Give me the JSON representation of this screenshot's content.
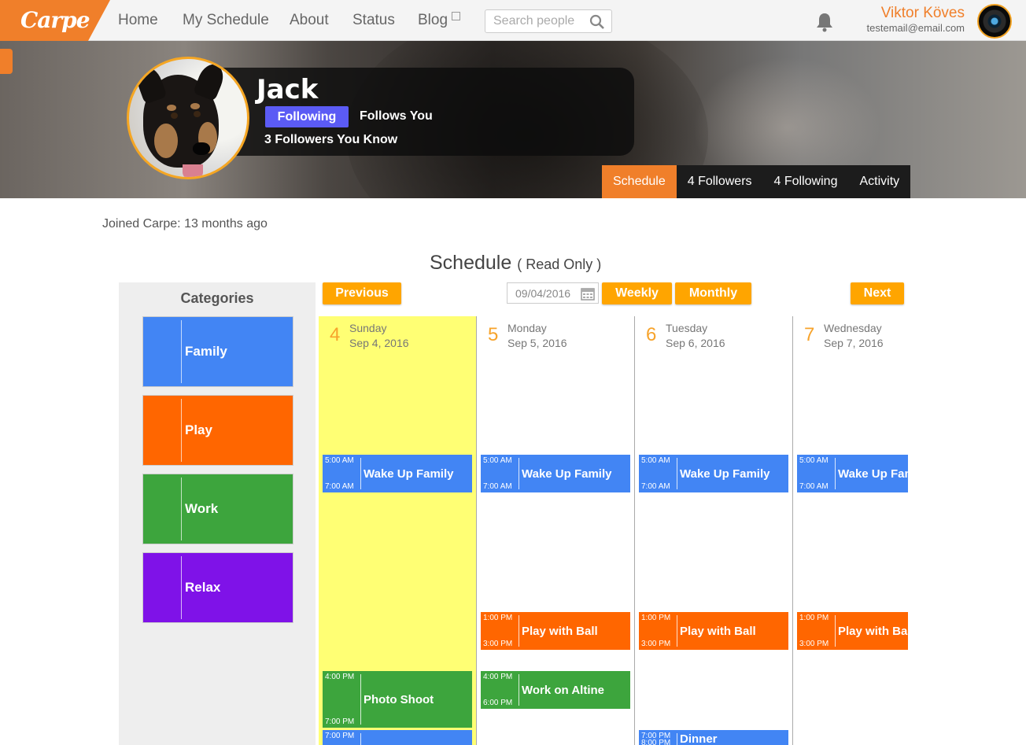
{
  "app": {
    "logo": "Carpe"
  },
  "nav": {
    "home": "Home",
    "my_schedule": "My Schedule",
    "about": "About",
    "status": "Status",
    "blog": "Blog"
  },
  "search": {
    "placeholder": "Search people"
  },
  "user": {
    "name": "Viktor Köves",
    "email": "testemail@email.com"
  },
  "profile": {
    "name": "Jack",
    "following_label": "Following",
    "follows_you": "Follows You",
    "followers_you_know": "3 Followers You Know",
    "tabs": [
      "Schedule",
      "4 Followers",
      "4 Following",
      "Activity"
    ],
    "joined": "Joined Carpe: 13 months ago"
  },
  "schedule": {
    "title": "Schedule",
    "subtitle": "( Read Only )",
    "previous": "Previous",
    "next": "Next",
    "weekly": "Weekly",
    "monthly": "Monthly",
    "date_value": "09/04/2016"
  },
  "categories": {
    "title": "Categories",
    "items": [
      {
        "label": "Family",
        "color": "#4285f4"
      },
      {
        "label": "Play",
        "color": "#ff6600"
      },
      {
        "label": "Work",
        "color": "#3da53d"
      },
      {
        "label": "Relax",
        "color": "#7f12e8"
      }
    ]
  },
  "days": [
    {
      "num": "4",
      "name": "Sunday",
      "date": "Sep 4, 2016",
      "today": true,
      "events": [
        {
          "title": "Wake Up Family",
          "start": "5:00 AM",
          "end": "7:00 AM",
          "category": "Family"
        },
        {
          "title": "Photo Shoot",
          "start": "4:00 PM",
          "end": "7:00 PM",
          "category": "Work"
        },
        {
          "title": "",
          "start": "7:00 PM",
          "end": "",
          "category": "Family"
        }
      ]
    },
    {
      "num": "5",
      "name": "Monday",
      "date": "Sep 5, 2016",
      "today": false,
      "events": [
        {
          "title": "Wake Up Family",
          "start": "5:00 AM",
          "end": "7:00 AM",
          "category": "Family"
        },
        {
          "title": "Play with Ball",
          "start": "1:00 PM",
          "end": "3:00 PM",
          "category": "Play"
        },
        {
          "title": "Work on Altine",
          "start": "4:00 PM",
          "end": "6:00 PM",
          "category": "Work"
        }
      ]
    },
    {
      "num": "6",
      "name": "Tuesday",
      "date": "Sep 6, 2016",
      "today": false,
      "events": [
        {
          "title": "Wake Up Family",
          "start": "5:00 AM",
          "end": "7:00 AM",
          "category": "Family"
        },
        {
          "title": "Play with Ball",
          "start": "1:00 PM",
          "end": "3:00 PM",
          "category": "Play"
        },
        {
          "title": "Dinner",
          "start": "7:00 PM",
          "end": "8:00 PM",
          "category": "Family"
        }
      ]
    },
    {
      "num": "7",
      "name": "Wednesday",
      "date": "Sep 7, 2016",
      "today": false,
      "events": [
        {
          "title": "Wake Up Family",
          "start": "5:00 AM",
          "end": "7:00 AM",
          "category": "Family"
        },
        {
          "title": "Play with Ball",
          "start": "1:00 PM",
          "end": "3:00 PM",
          "category": "Play"
        }
      ]
    }
  ]
}
